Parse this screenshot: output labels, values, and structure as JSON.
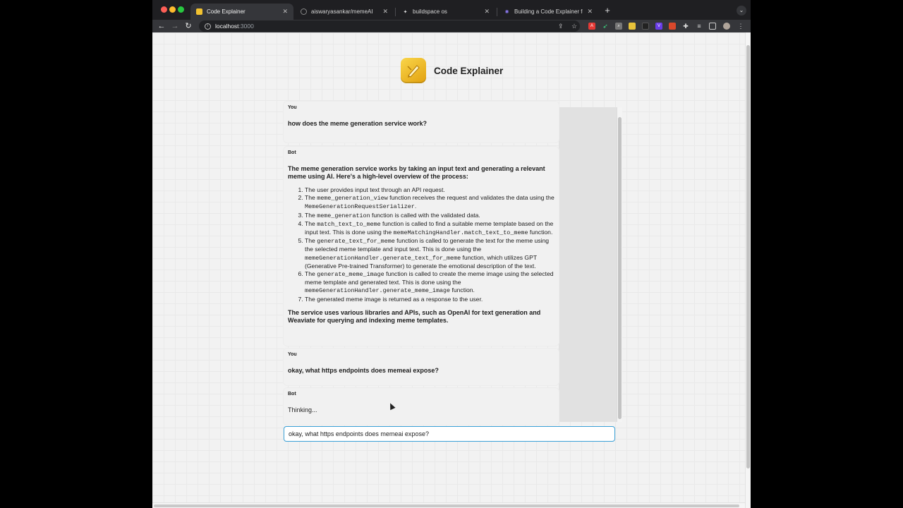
{
  "browser": {
    "tabs": [
      {
        "label": "Code Explainer",
        "active": true
      },
      {
        "label": "aiswaryasankar/memeAI",
        "active": false
      },
      {
        "label": "buildspace os",
        "active": false
      },
      {
        "label": "Building a Code Explainer for C",
        "active": false
      }
    ],
    "url_host": "localhost",
    "url_port": ":3000"
  },
  "app": {
    "title": "Code Explainer"
  },
  "chat": {
    "messages": [
      {
        "sender": "You",
        "text": "how does the meme generation service work?"
      },
      {
        "sender": "Bot",
        "intro": "The meme generation service works by taking an input text and generating a relevant meme using AI. Here's a high-level overview of the process:",
        "steps": [
          [
            {
              "t": "The user provides input text through an API request."
            }
          ],
          [
            {
              "t": "The "
            },
            {
              "c": "meme_generation_view"
            },
            {
              "t": " function receives the request and validates the data using the "
            },
            {
              "c": "MemeGenerationRequestSerializer"
            },
            {
              "t": "."
            }
          ],
          [
            {
              "t": "The "
            },
            {
              "c": "meme_generation"
            },
            {
              "t": " function is called with the validated data."
            }
          ],
          [
            {
              "t": "The "
            },
            {
              "c": "match_text_to_meme"
            },
            {
              "t": " function is called to find a suitable meme template based on the input text. This is done using the "
            },
            {
              "c": "memeMatchingHandler.match_text_to_meme"
            },
            {
              "t": " function."
            }
          ],
          [
            {
              "t": "The "
            },
            {
              "c": "generate_text_for_meme"
            },
            {
              "t": " function is called to generate the text for the meme using the selected meme template and input text. This is done using the "
            },
            {
              "c": "memeGenerationHandler.generate_text_for_meme"
            },
            {
              "t": " function, which utilizes GPT (Generative Pre-trained Transformer) to generate the emotional description of the text."
            }
          ],
          [
            {
              "t": "The "
            },
            {
              "c": "generate_meme_image"
            },
            {
              "t": " function is called to create the meme image using the selected meme template and generated text. This is done using the "
            },
            {
              "c": "memeGenerationHandler.generate_meme_image"
            },
            {
              "t": " function."
            }
          ],
          [
            {
              "t": "The generated meme image is returned as a response to the user."
            }
          ]
        ],
        "outro": "The service uses various libraries and APIs, such as OpenAI for text generation and Weaviate for querying and indexing meme templates."
      },
      {
        "sender": "You",
        "text": "okay, what https endpoints does memeai expose?"
      },
      {
        "sender": "Bot",
        "text": "Thinking..."
      }
    ],
    "input_value": "okay, what https endpoints does memeai expose?"
  },
  "colors": {
    "accent": "#3aa0d6",
    "logo": "#f2c230"
  }
}
